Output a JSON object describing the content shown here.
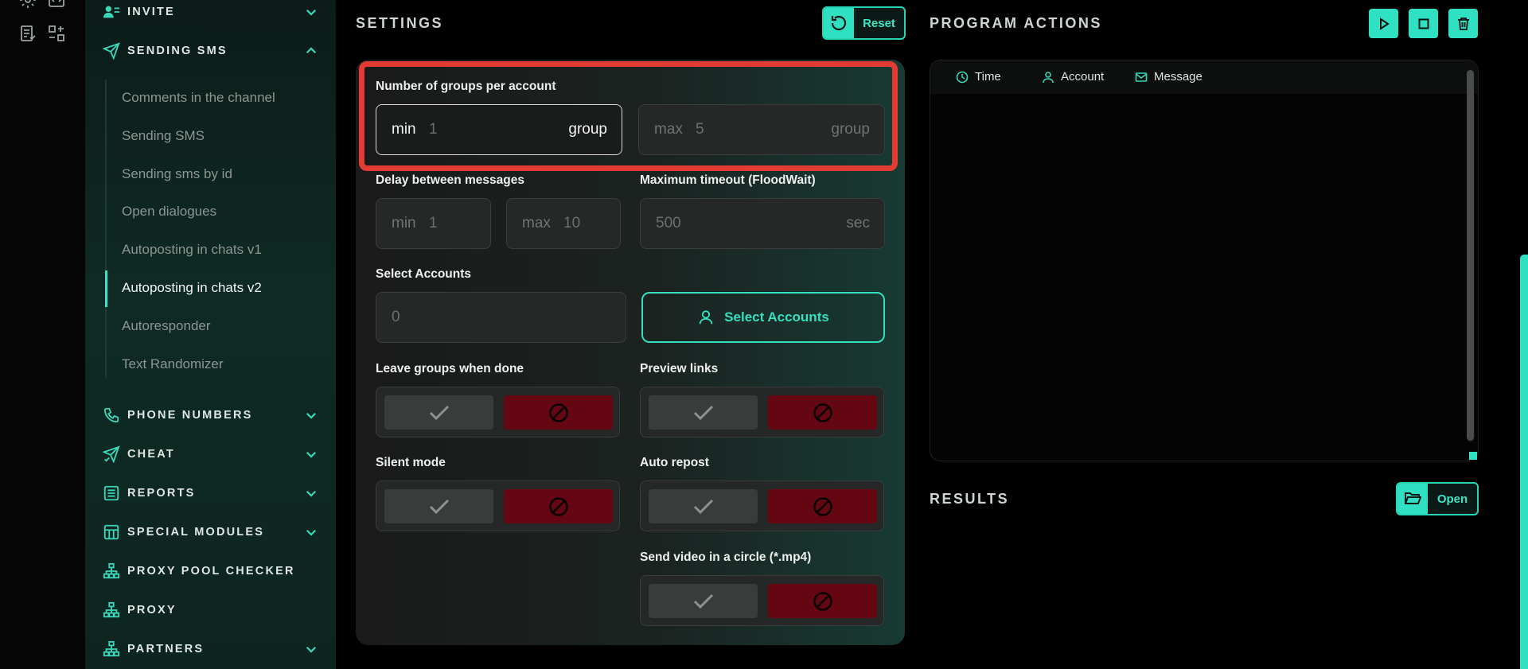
{
  "sidebar": {
    "sections": {
      "invite": "INVITE",
      "sending_sms": "SENDING SMS",
      "phone_numbers": "PHONE NUMBERS",
      "cheat": "CHEAT",
      "reports": "REPORTS",
      "special_modules": "SPECIAL MODULES",
      "proxy_pool_checker": "PROXY POOL CHECKER",
      "proxy": "PROXY",
      "partners": "PARTNERS"
    },
    "sub_items": [
      "Comments in the channel",
      "Sending SMS",
      "Sending sms by id",
      "Open dialogues",
      "Autoposting in chats v1",
      "Autoposting in chats v2",
      "Autoresponder",
      "Text Randomizer"
    ],
    "active_item": "Autoposting in chats v2"
  },
  "settings": {
    "title": "SETTINGS",
    "reset_label": "Reset",
    "groups_per_account": {
      "label": "Number of groups per account",
      "min_prefix": "min",
      "min_value": "1",
      "min_unit": "group",
      "max_prefix": "max",
      "max_value": "5",
      "max_unit": "group"
    },
    "delay": {
      "label": "Delay between messages",
      "min_prefix": "min",
      "min_value": "1",
      "max_prefix": "max",
      "max_value": "10"
    },
    "timeout": {
      "label": "Maximum timeout (FloodWait)",
      "value": "500",
      "unit": "sec"
    },
    "select_accounts": {
      "label": "Select Accounts",
      "count": "0",
      "button_label": "Select Accounts"
    },
    "toggles": {
      "leave_groups": "Leave groups when done",
      "preview_links": "Preview links",
      "silent_mode": "Silent mode",
      "auto_repost": "Auto repost",
      "send_video": "Send video in a circle (*.mp4)"
    }
  },
  "actions": {
    "title": "PROGRAM ACTIONS",
    "columns": {
      "time": "Time",
      "account": "Account",
      "message": "Message"
    }
  },
  "results": {
    "title": "RESULTS",
    "open_label": "Open"
  },
  "colors": {
    "accent": "#2fe0c2",
    "danger": "#650712",
    "highlight": "#e23b33"
  }
}
